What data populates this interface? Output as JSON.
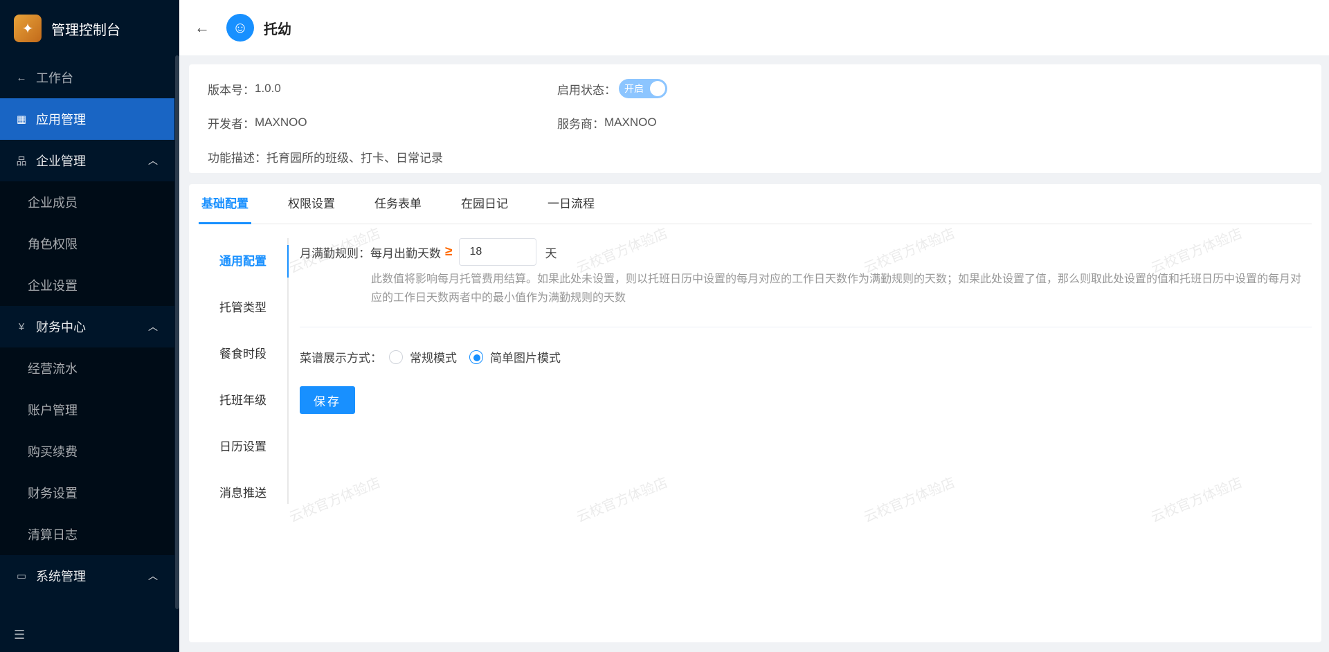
{
  "sidebar": {
    "logo_text": "管理控制台",
    "workbench": "工作台",
    "app_mgmt": "应用管理",
    "enterprise": {
      "label": "企业管理",
      "items": [
        "企业成员",
        "角色权限",
        "企业设置"
      ]
    },
    "finance": {
      "label": "财务中心",
      "items": [
        "经营流水",
        "账户管理",
        "购买续费",
        "财务设置",
        "清算日志"
      ]
    },
    "system": {
      "label": "系统管理"
    }
  },
  "header": {
    "title": "托幼"
  },
  "info": {
    "version_label": "版本号：",
    "version": "1.0.0",
    "status_label": "启用状态：",
    "status_toggle": "开启",
    "developer_label": "开发者：",
    "developer": "MAXNOO",
    "provider_label": "服务商：",
    "provider": "MAXNOO",
    "desc_label": "功能描述：",
    "desc": "托育园所的班级、打卡、日常记录"
  },
  "tabs": [
    "基础配置",
    "权限设置",
    "任务表单",
    "在园日记",
    "一日流程"
  ],
  "vtabs": [
    "通用配置",
    "托管类型",
    "餐食时段",
    "托班年级",
    "日历设置",
    "消息推送"
  ],
  "form": {
    "attendance_label": "月满勤规则：",
    "attendance_text": "每月出勤天数",
    "ge": "≥",
    "days_value": "18",
    "unit": "天",
    "hint": "此数值将影响每月托管费用结算。如果此处未设置，则以托班日历中设置的每月对应的工作日天数作为满勤规则的天数；如果此处设置了值，那么则取此处设置的值和托班日历中设置的每月对应的工作日天数两者中的最小值作为满勤规则的天数",
    "menu_label": "菜谱展示方式：",
    "opt_normal": "常规模式",
    "opt_image": "简单图片模式",
    "save": "保存"
  },
  "watermark": "云校官方体验店",
  "colors": {
    "accent": "#1890ff",
    "sidebar_bg": "#001529",
    "active_nav": "#1965c4",
    "ge_color": "#ff6a00"
  }
}
